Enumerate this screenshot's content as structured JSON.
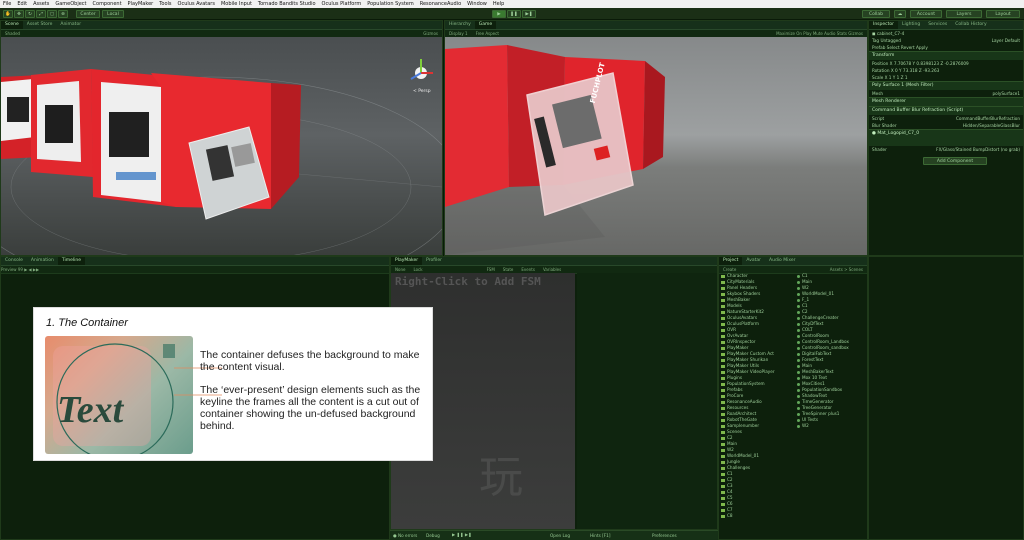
{
  "menu": [
    "File",
    "Edit",
    "Assets",
    "GameObject",
    "Component",
    "PlayMaker",
    "Tools",
    "Oculus Avatars",
    "Mobile Input",
    "Tornado Bandits Studio",
    "Oculus Platform",
    "Population System",
    "ResonanceAudio",
    "Window",
    "Help"
  ],
  "toolbar": {
    "center": "Center",
    "local": "Local",
    "collab": "Collab",
    "account": "Account",
    "layers": "Layers",
    "layout": "Layout"
  },
  "scene": {
    "tabs": [
      "Scene",
      "Asset Store",
      "Animator"
    ],
    "shading": "Shaded",
    "gizmos": "Gizmos",
    "persp": "< Persp"
  },
  "game": {
    "tabs": [
      "Hierarchy",
      "Game"
    ],
    "display": "Display 1",
    "aspect": "Free Aspect",
    "stats": "Maximize On Play  Mute Audio  Stats  Gizmos"
  },
  "inspector": {
    "tabs": [
      "Inspector",
      "Lighting",
      "Services",
      "Collab History"
    ],
    "object_name": "cabinet_C7-4",
    "tag_label": "Tag",
    "tag_value": "Untagged",
    "layer_label": "Layer",
    "layer_value": "Default",
    "prefab_row": "Prefab  Select  Revert  Apply",
    "transform_header": "Transform",
    "position": "Position  X 7.70678   Y 0.8398123   Z -0.2876009",
    "rotation": "Rotation  X 0   Y 73.318   Z -93.263",
    "scale": "Scale  X 1   Y 1   Z 1",
    "mesh_filter": "Poly Surface 1 (Mesh Filter)",
    "mesh_label": "Mesh",
    "mesh_value": "polySurface1",
    "mesh_renderer": "Mesh Renderer",
    "blur_script": "Command Buffer Blur Refraction (Script)",
    "script_label": "Script",
    "script_value": "CommandBufferBlurRefraction",
    "blur_shader_label": "Blur Shader",
    "blur_shader_value": "Hidden/SeparableGlassBlur",
    "material_name": "Mat_Logopid_C7_0",
    "shader_label": "Shader",
    "shader_value": "FX/Glass/Stained BumpDistort (no grab)",
    "add_component": "Add Component"
  },
  "bottom_left": {
    "tabs": [
      "Console",
      "Animation",
      "Timeline"
    ],
    "controls": "Preview  99  ▶  ◀  ▶▶"
  },
  "fsm": {
    "tabs": [
      "PlayMaker",
      "Profiler"
    ],
    "none": "None",
    "lock": "Lock",
    "right_tabs": [
      "FSM",
      "State",
      "Events",
      "Variables"
    ],
    "hint": "Right-Click to Add FSM",
    "watermark": "玩",
    "status": {
      "errors": "No errors",
      "debug": "Debug",
      "open_log": "Open Log",
      "hints": "Hints [F1]",
      "preferences": "Preferences"
    }
  },
  "project": {
    "tabs": [
      "Project",
      "Avatar",
      "Audio Mixer"
    ],
    "create": "Create",
    "tree": [
      "Character",
      "CityMaterials",
      "Panel Headers",
      "Skybox Shaders",
      "MeshBaker",
      "Models",
      "NatureStarterKit2",
      "OculusAvatars",
      "OculusPlatform",
      "OVR",
      "OvrAvatar",
      "OVRInspector",
      "PlayMaker",
      "PlayMaker Custom Act",
      "PlayMaker Shurikan",
      "PlayMaker Utils",
      "PlayMaker VideoPlayer",
      "Plugins",
      "PopulationSystem",
      "Prefabs",
      "ProCore",
      "ResonanceAudio",
      "Resources",
      "RoadArchitect",
      "RobotTheGate",
      "Samplenumber",
      "Scenes",
      "C2",
      "Main",
      "W2",
      "WorldModel_01",
      "Jungle",
      "Challenges",
      "C1",
      "C2",
      "C3",
      "C4",
      "C5",
      "C6",
      "C7",
      "C8"
    ],
    "breadcrumb": "Assets > Scenes",
    "assets": [
      "C1",
      "Main",
      "W2",
      "WorldModel_01",
      "F_1",
      "C1",
      "C2",
      "ChallengeCreater",
      "CityDfText",
      "COLT",
      "ControlRoom",
      "ControlRoom_Landbox",
      "ControlRoom_sandbox",
      "DigitalFabText",
      "ForestText",
      "Main",
      "MeshBakerText",
      "Mox 10 Text",
      "MoxCities1",
      "PopulationSandbox",
      "ShadowText",
      "TimeGenerator",
      "TreeGenerator",
      "TreeSpinner plus1",
      "UI Tests",
      "W2"
    ]
  },
  "overlay": {
    "title": "1. The Container",
    "thumb_text": "Text",
    "para1": "The container defuses the background to make the content visual.",
    "para2": "The ‘ever-present’ design elements such as the keyline the frames all the content is a cut out of container showing the un-defused background behind."
  },
  "game_kiosk_text": "FUCHPLOT"
}
